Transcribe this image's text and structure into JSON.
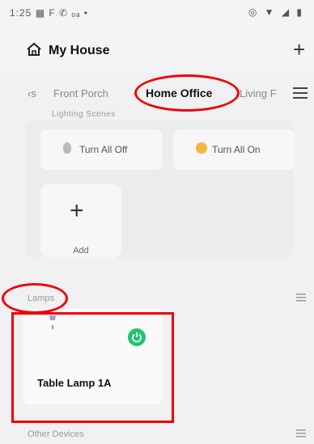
{
  "status_bar": {
    "time": "1:25",
    "left_icons": "▦ F ✆ ₒₐ •",
    "right_icons": "◎ ▼ ◢ ▮"
  },
  "header": {
    "title": "My House",
    "house_icon": "house-icon",
    "add_icon": "plus-icon"
  },
  "tabs": {
    "items": [
      {
        "label": "‹s"
      },
      {
        "label": "Front Porch"
      },
      {
        "label": "Home Office",
        "active": true
      },
      {
        "label": "Living F"
      }
    ]
  },
  "scenes": {
    "section_label": "Lighting Scenes",
    "turn_all_off": "Turn All Off",
    "turn_all_on": "Turn All On",
    "add_label": "Add"
  },
  "lamps": {
    "section_label": "Lamps",
    "device": {
      "name": "Table Lamp 1A",
      "power_on": true
    }
  },
  "other_devices": {
    "section_label": "Other Devices"
  },
  "colors": {
    "accent_green": "#21c46f",
    "bulb_on": "#f4b63a",
    "annotation_red": "#e00000"
  }
}
